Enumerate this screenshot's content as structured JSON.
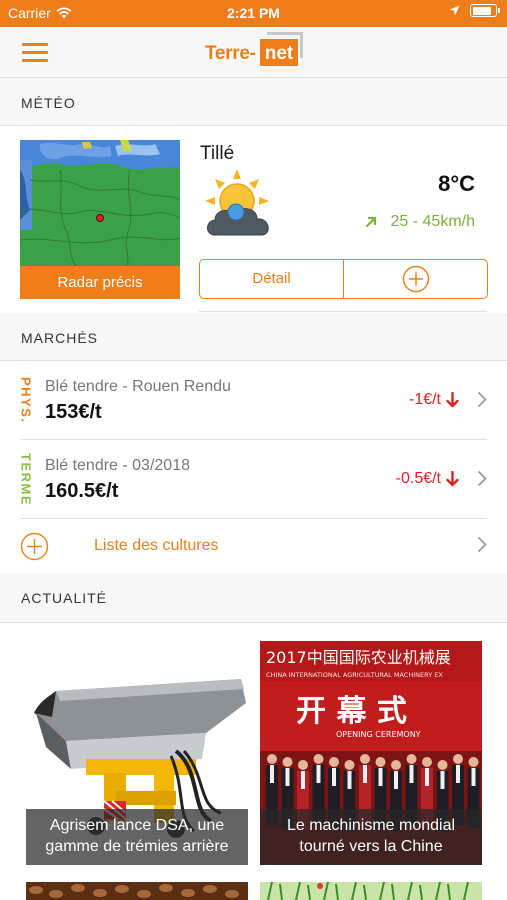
{
  "status_bar": {
    "carrier": "Carrier",
    "time": "2:21 PM",
    "battery_level": 0.9
  },
  "nav": {
    "logo_part1": "Terre-",
    "logo_part2": "net"
  },
  "colors": {
    "accent": "#ee7d1a",
    "positive": "#7ab23c",
    "negative": "#e02020",
    "terme_green": "#8cc04a"
  },
  "meteo": {
    "title": "MÉTÉO",
    "radar_label": "Radar précis",
    "city": "Tillé",
    "weather_icon": "partly-cloudy-icon",
    "temperature": "8°C",
    "wind": "25 - 45km/h",
    "detail_label": "Détail"
  },
  "marches": {
    "title": "MARCHÉS",
    "rows": [
      {
        "tag": "PHYS.",
        "name": "Blé tendre - Rouen Rendu",
        "price": "153€/t",
        "change": "-1€/t"
      },
      {
        "tag": "TERME",
        "name": "Blé tendre - 03/2018",
        "price": "160.5€/t",
        "change": "-0.5€/t"
      }
    ],
    "list_label": "Liste des cultures"
  },
  "actualite": {
    "title": "ACTUALITÉ",
    "articles": [
      {
        "caption_line1": "Agrisem lance DSA, une",
        "caption_line2": "gamme de trémies arrière"
      },
      {
        "caption_line1": "Le machinisme mondial",
        "caption_line2": "tourné vers la Chine"
      }
    ],
    "banner_cn": "2017中国国际农业机械展",
    "banner_en": "CHINA INTERNATIONAL AGRICULTURAL MACHINERY EX",
    "ceremony_cn": "开 幕 式",
    "ceremony_en": "OPENING CEREMONY"
  }
}
